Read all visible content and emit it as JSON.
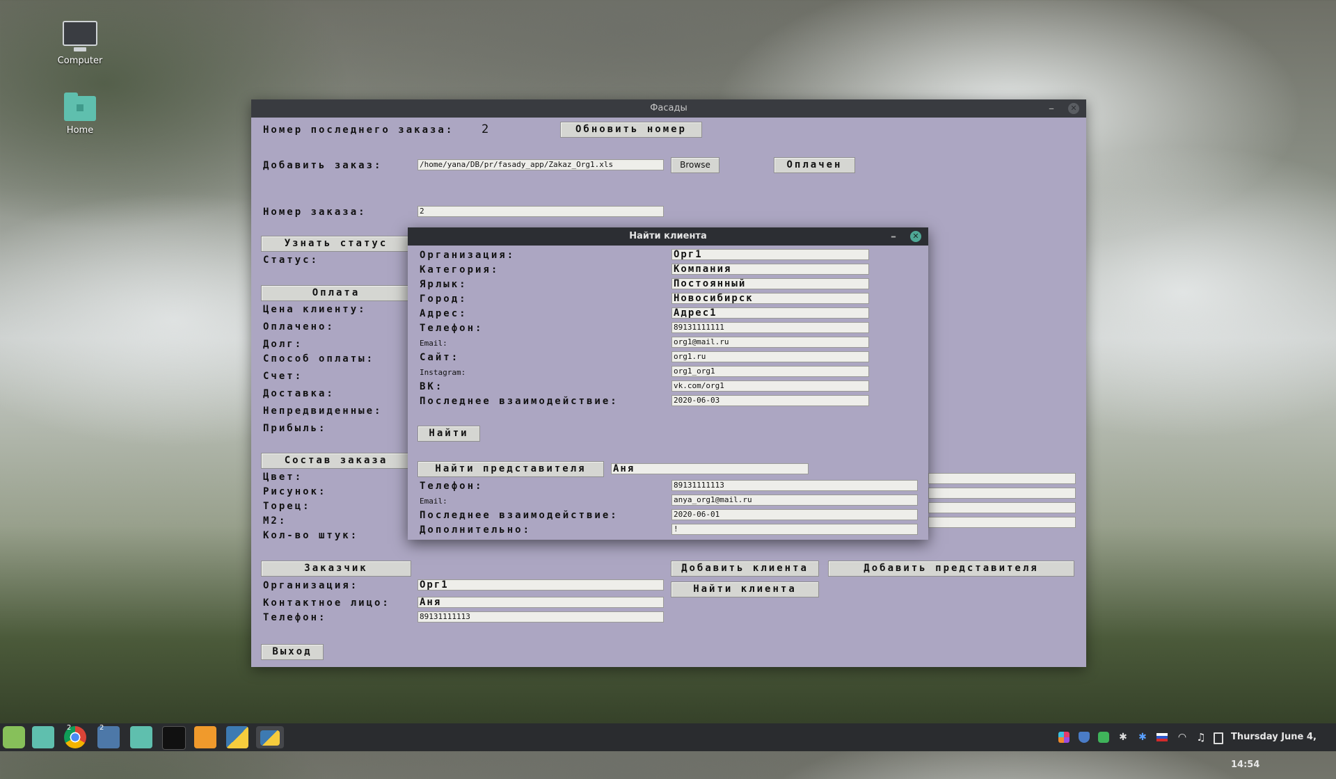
{
  "desktop": {
    "icons": [
      {
        "label": "Computer"
      },
      {
        "label": "Home"
      }
    ]
  },
  "main_window": {
    "title": "Фасады",
    "last_order_label": "Номер последнего заказа:",
    "last_order_value": "2",
    "refresh_button": "Обновить номер",
    "add_order_label": "Добавить заказ:",
    "add_order_path": "/home/yana/DB/pr/fasady_app/Zakaz_Org1.xls",
    "browse_button": "Browse",
    "paid_button": "Оплачен",
    "order_number_label": "Номер заказа:",
    "order_number_value": "2",
    "status_button": "Узнать статус",
    "status_label": "Статус:",
    "payment_button": "Оплата",
    "payment_fields": [
      "Цена клиенту:",
      "Оплачено:",
      "Долг:",
      "Способ оплаты:",
      "Счет:",
      "Доставка:",
      "Непредвиденные:",
      "Прибыль:"
    ],
    "composition_button": "Состав заказа",
    "composition_fields": [
      "Цвет:",
      "Рисунок:",
      "Торец:",
      "М2:",
      "Кол-во штук:"
    ],
    "customer_button": "Заказчик",
    "customer_org_label": "Организация:",
    "customer_org_value": "Орг1",
    "customer_contact_label": "Контактное лицо:",
    "customer_contact_value": "Аня",
    "customer_phone_label": "Телефон:",
    "customer_phone_value": "89131111113",
    "add_client_button": "Добавить клиента",
    "add_rep_button": "Добавить представителя",
    "find_client_button": "Найти клиента",
    "exit_button": "Выход"
  },
  "dialog": {
    "title": "Найти клиента",
    "fields": [
      {
        "label": "Организация:",
        "value": "Орг1"
      },
      {
        "label": "Категория:",
        "value": "Компания"
      },
      {
        "label": "Ярлык:",
        "value": "Постоянный"
      },
      {
        "label": "Город:",
        "value": "Новосибирск"
      },
      {
        "label": "Адрес:",
        "value": "Адрес1"
      },
      {
        "label": "Телефон:",
        "value": "89131111111"
      },
      {
        "label": "Email:",
        "value": "org1@mail.ru"
      },
      {
        "label": "Сайт:",
        "value": "org1.ru"
      },
      {
        "label": "Instagram:",
        "value": "org1_org1"
      },
      {
        "label": "ВК:",
        "value": "vk.com/org1"
      },
      {
        "label": "Последнее взаимодействие:",
        "value": "2020-06-03"
      }
    ],
    "find_button": "Найти",
    "find_rep_button": "Найти представителя",
    "rep_search_value": "Аня",
    "rep_fields": [
      {
        "label": "Телефон:",
        "value": "89131111113"
      },
      {
        "label": "Email:",
        "value": "anya_org1@mail.ru"
      },
      {
        "label": "Последнее взаимодействие:",
        "value": "2020-06-01"
      },
      {
        "label": "Дополнительно:",
        "value": "!"
      }
    ]
  },
  "taskbar": {
    "badge_chrome": "2",
    "badge_camera": "2",
    "clock": "Thursday June 4, 14:54"
  },
  "colors": {
    "window_bg": "#aca6c2",
    "titlebar": "#393b40",
    "taskbar": "#2a2c2f",
    "accent": "#4fa896"
  }
}
